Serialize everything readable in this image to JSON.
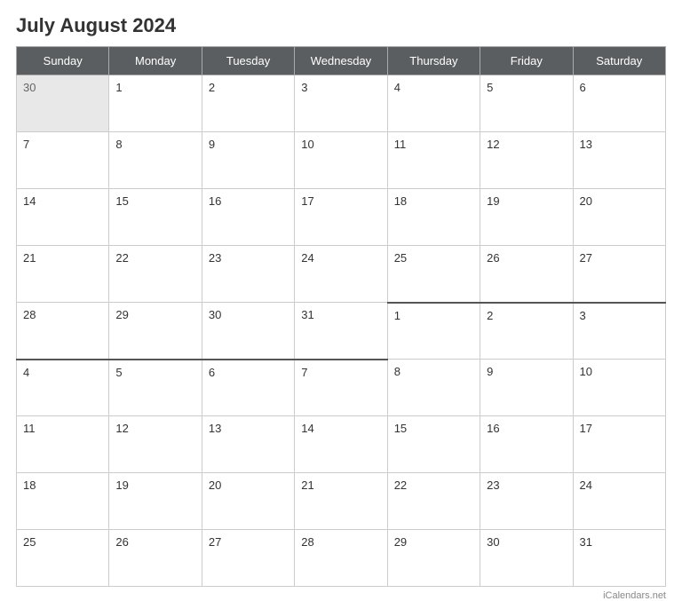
{
  "title": "July August 2024",
  "days_of_week": [
    "Sunday",
    "Monday",
    "Tuesday",
    "Wednesday",
    "Thursday",
    "Friday",
    "Saturday"
  ],
  "weeks": [
    {
      "july": true,
      "cells": [
        {
          "day": "30",
          "greyed": true
        },
        {
          "day": "1"
        },
        {
          "day": "2"
        },
        {
          "day": "3"
        },
        {
          "day": "4"
        },
        {
          "day": "5"
        },
        {
          "day": "6"
        }
      ]
    },
    {
      "july": true,
      "cells": [
        {
          "day": "7"
        },
        {
          "day": "8"
        },
        {
          "day": "9"
        },
        {
          "day": "10"
        },
        {
          "day": "11"
        },
        {
          "day": "12"
        },
        {
          "day": "13"
        }
      ]
    },
    {
      "july": true,
      "cells": [
        {
          "day": "14"
        },
        {
          "day": "15"
        },
        {
          "day": "16"
        },
        {
          "day": "17"
        },
        {
          "day": "18"
        },
        {
          "day": "19"
        },
        {
          "day": "20"
        }
      ]
    },
    {
      "july": true,
      "cells": [
        {
          "day": "21"
        },
        {
          "day": "22"
        },
        {
          "day": "23"
        },
        {
          "day": "24"
        },
        {
          "day": "25"
        },
        {
          "day": "26"
        },
        {
          "day": "27"
        }
      ]
    },
    {
      "transition": true,
      "cells": [
        {
          "day": "28",
          "july_end": true
        },
        {
          "day": "29",
          "july_end": true
        },
        {
          "day": "30",
          "july_end": true
        },
        {
          "day": "31",
          "july_end": true
        },
        {
          "day": "1",
          "august_start": true
        },
        {
          "day": "2",
          "august_start": true
        },
        {
          "day": "3",
          "august_start": true
        }
      ]
    },
    {
      "august": true,
      "cells": [
        {
          "day": "4"
        },
        {
          "day": "5"
        },
        {
          "day": "6"
        },
        {
          "day": "7"
        },
        {
          "day": "8"
        },
        {
          "day": "9"
        },
        {
          "day": "10"
        }
      ]
    },
    {
      "august": true,
      "cells": [
        {
          "day": "11"
        },
        {
          "day": "12"
        },
        {
          "day": "13"
        },
        {
          "day": "14"
        },
        {
          "day": "15"
        },
        {
          "day": "16"
        },
        {
          "day": "17"
        }
      ]
    },
    {
      "august": true,
      "cells": [
        {
          "day": "18"
        },
        {
          "day": "19"
        },
        {
          "day": "20"
        },
        {
          "day": "21"
        },
        {
          "day": "22"
        },
        {
          "day": "23"
        },
        {
          "day": "24"
        }
      ]
    },
    {
      "august": true,
      "cells": [
        {
          "day": "25"
        },
        {
          "day": "26"
        },
        {
          "day": "27"
        },
        {
          "day": "28"
        },
        {
          "day": "29"
        },
        {
          "day": "30"
        },
        {
          "day": "31"
        }
      ]
    }
  ],
  "watermark": "iCalendars.net"
}
